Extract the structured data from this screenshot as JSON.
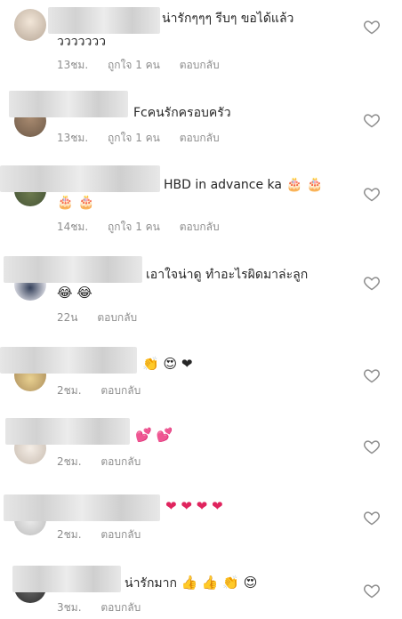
{
  "comments": [
    {
      "line1": "น่ารักๆๆๆ รีบๆ ขอได้แล้ว",
      "line2": "ววววววว",
      "time": "13ชม.",
      "likes": "ถูกใจ 1 คน",
      "reply": "ตอบกลับ"
    },
    {
      "line1": "Fcคนรักครอบครัว",
      "time": "13ชม.",
      "likes": "ถูกใจ 1 คน",
      "reply": "ตอบกลับ"
    },
    {
      "line1": "HBD in advance ka",
      "line1_emoji": "🎂 🎂",
      "line2": "🎂 🎂",
      "time": "14ชม.",
      "likes": "ถูกใจ 1 คน",
      "reply": "ตอบกลับ"
    },
    {
      "line1": "เอาใจน่าดู ทำอะไรผิดมาล่ะลูก",
      "line2": "😂 😂",
      "time": "22น",
      "reply": "ตอบกลับ"
    },
    {
      "line1": "👏 😍 ❤",
      "time": "2ชม.",
      "reply": "ตอบกลับ"
    },
    {
      "line1": "💕 💕",
      "time": "2ชม.",
      "reply": "ตอบกลับ"
    },
    {
      "line1": "❤ ❤ ❤ ❤",
      "time": "2ชม.",
      "reply": "ตอบกลับ"
    },
    {
      "line1": "น่ารักมาก",
      "line1_emoji": "👍 👍 👏 😍",
      "time": "3ชม.",
      "reply": "ตอบกลับ"
    }
  ],
  "icons": {
    "like": "heart-outline-icon"
  },
  "colors": {
    "text": "#262626",
    "meta": "#8e8e8e",
    "icon": "#8e8e8e"
  }
}
